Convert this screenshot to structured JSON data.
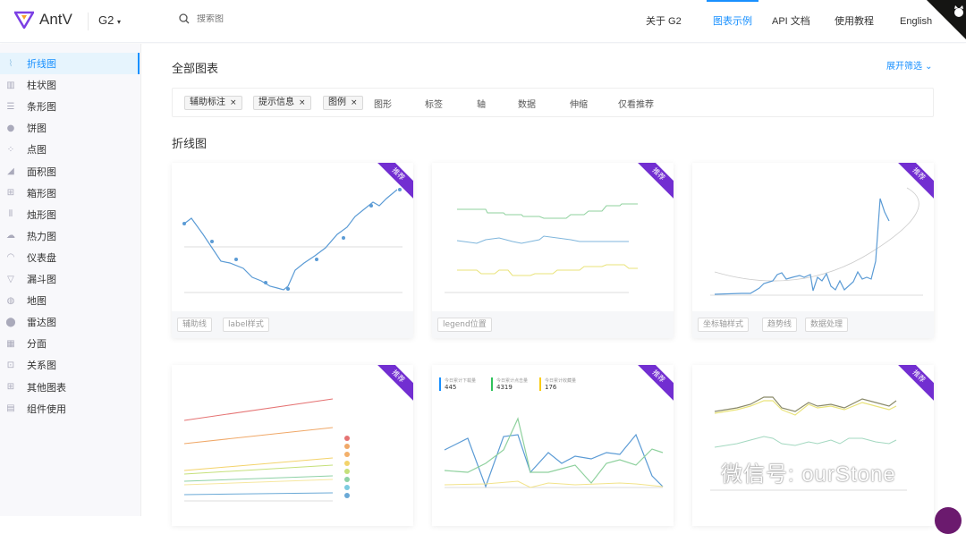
{
  "header": {
    "brand": "AntV",
    "product": "G2",
    "product_caret": "▾",
    "search_placeholder": "搜索图",
    "nav": [
      {
        "label": "关于 G2",
        "active": false
      },
      {
        "label": "图表示例",
        "active": true
      },
      {
        "label": "API 文档",
        "active": false
      },
      {
        "label": "使用教程",
        "active": false
      },
      {
        "label": "English",
        "active": false
      }
    ],
    "accent": "#1890ff"
  },
  "sidebar": {
    "items": [
      {
        "label": "折线图",
        "icon": "line-chart-icon",
        "active": true
      },
      {
        "label": "柱状图",
        "icon": "bar-chart-icon"
      },
      {
        "label": "条形图",
        "icon": "horizontal-bar-icon"
      },
      {
        "label": "饼图",
        "icon": "pie-chart-icon"
      },
      {
        "label": "点图",
        "icon": "dot-chart-icon"
      },
      {
        "label": "面积图",
        "icon": "area-chart-icon"
      },
      {
        "label": "箱形图",
        "icon": "box-plot-icon"
      },
      {
        "label": "烛形图",
        "icon": "candlestick-icon"
      },
      {
        "label": "热力图",
        "icon": "heatmap-icon"
      },
      {
        "label": "仪表盘",
        "icon": "gauge-icon"
      },
      {
        "label": "漏斗图",
        "icon": "funnel-icon"
      },
      {
        "label": "地图",
        "icon": "map-icon"
      },
      {
        "label": "雷达图",
        "icon": "radar-icon"
      },
      {
        "label": "分面",
        "icon": "facet-icon"
      },
      {
        "label": "关系图",
        "icon": "relation-icon"
      },
      {
        "label": "其他图表",
        "icon": "other-chart-icon"
      },
      {
        "label": "组件使用",
        "icon": "component-icon"
      }
    ]
  },
  "main": {
    "title": "全部图表",
    "expand_label": "展开筛选",
    "selected_tags": [
      "辅助标注",
      "提示信息",
      "图例"
    ],
    "tag_close": "×",
    "filters": [
      "图形",
      "标签",
      "轴",
      "数据",
      "伸缩",
      "仅看推荐"
    ],
    "section_title": "折线图",
    "ribbon_label": "推荐",
    "cards": [
      {
        "tags": [
          "辅助线",
          "label样式"
        ]
      },
      {
        "tags": [
          "legend位置"
        ]
      },
      {
        "tags": [
          "坐标轴样式",
          "趋势线",
          "数据处理"
        ]
      },
      {
        "tags": []
      },
      {
        "tags": [],
        "stats": [
          {
            "label": "今日累计下载量",
            "value": "445",
            "color": "#1890ff"
          },
          {
            "label": "今日累计点击量",
            "value": "4319",
            "color": "#2fc25b"
          },
          {
            "label": "今日累计收藏量",
            "value": "176",
            "color": "#facc14"
          }
        ]
      },
      {
        "tags": []
      }
    ]
  },
  "watermark": "微信号: ourStone"
}
